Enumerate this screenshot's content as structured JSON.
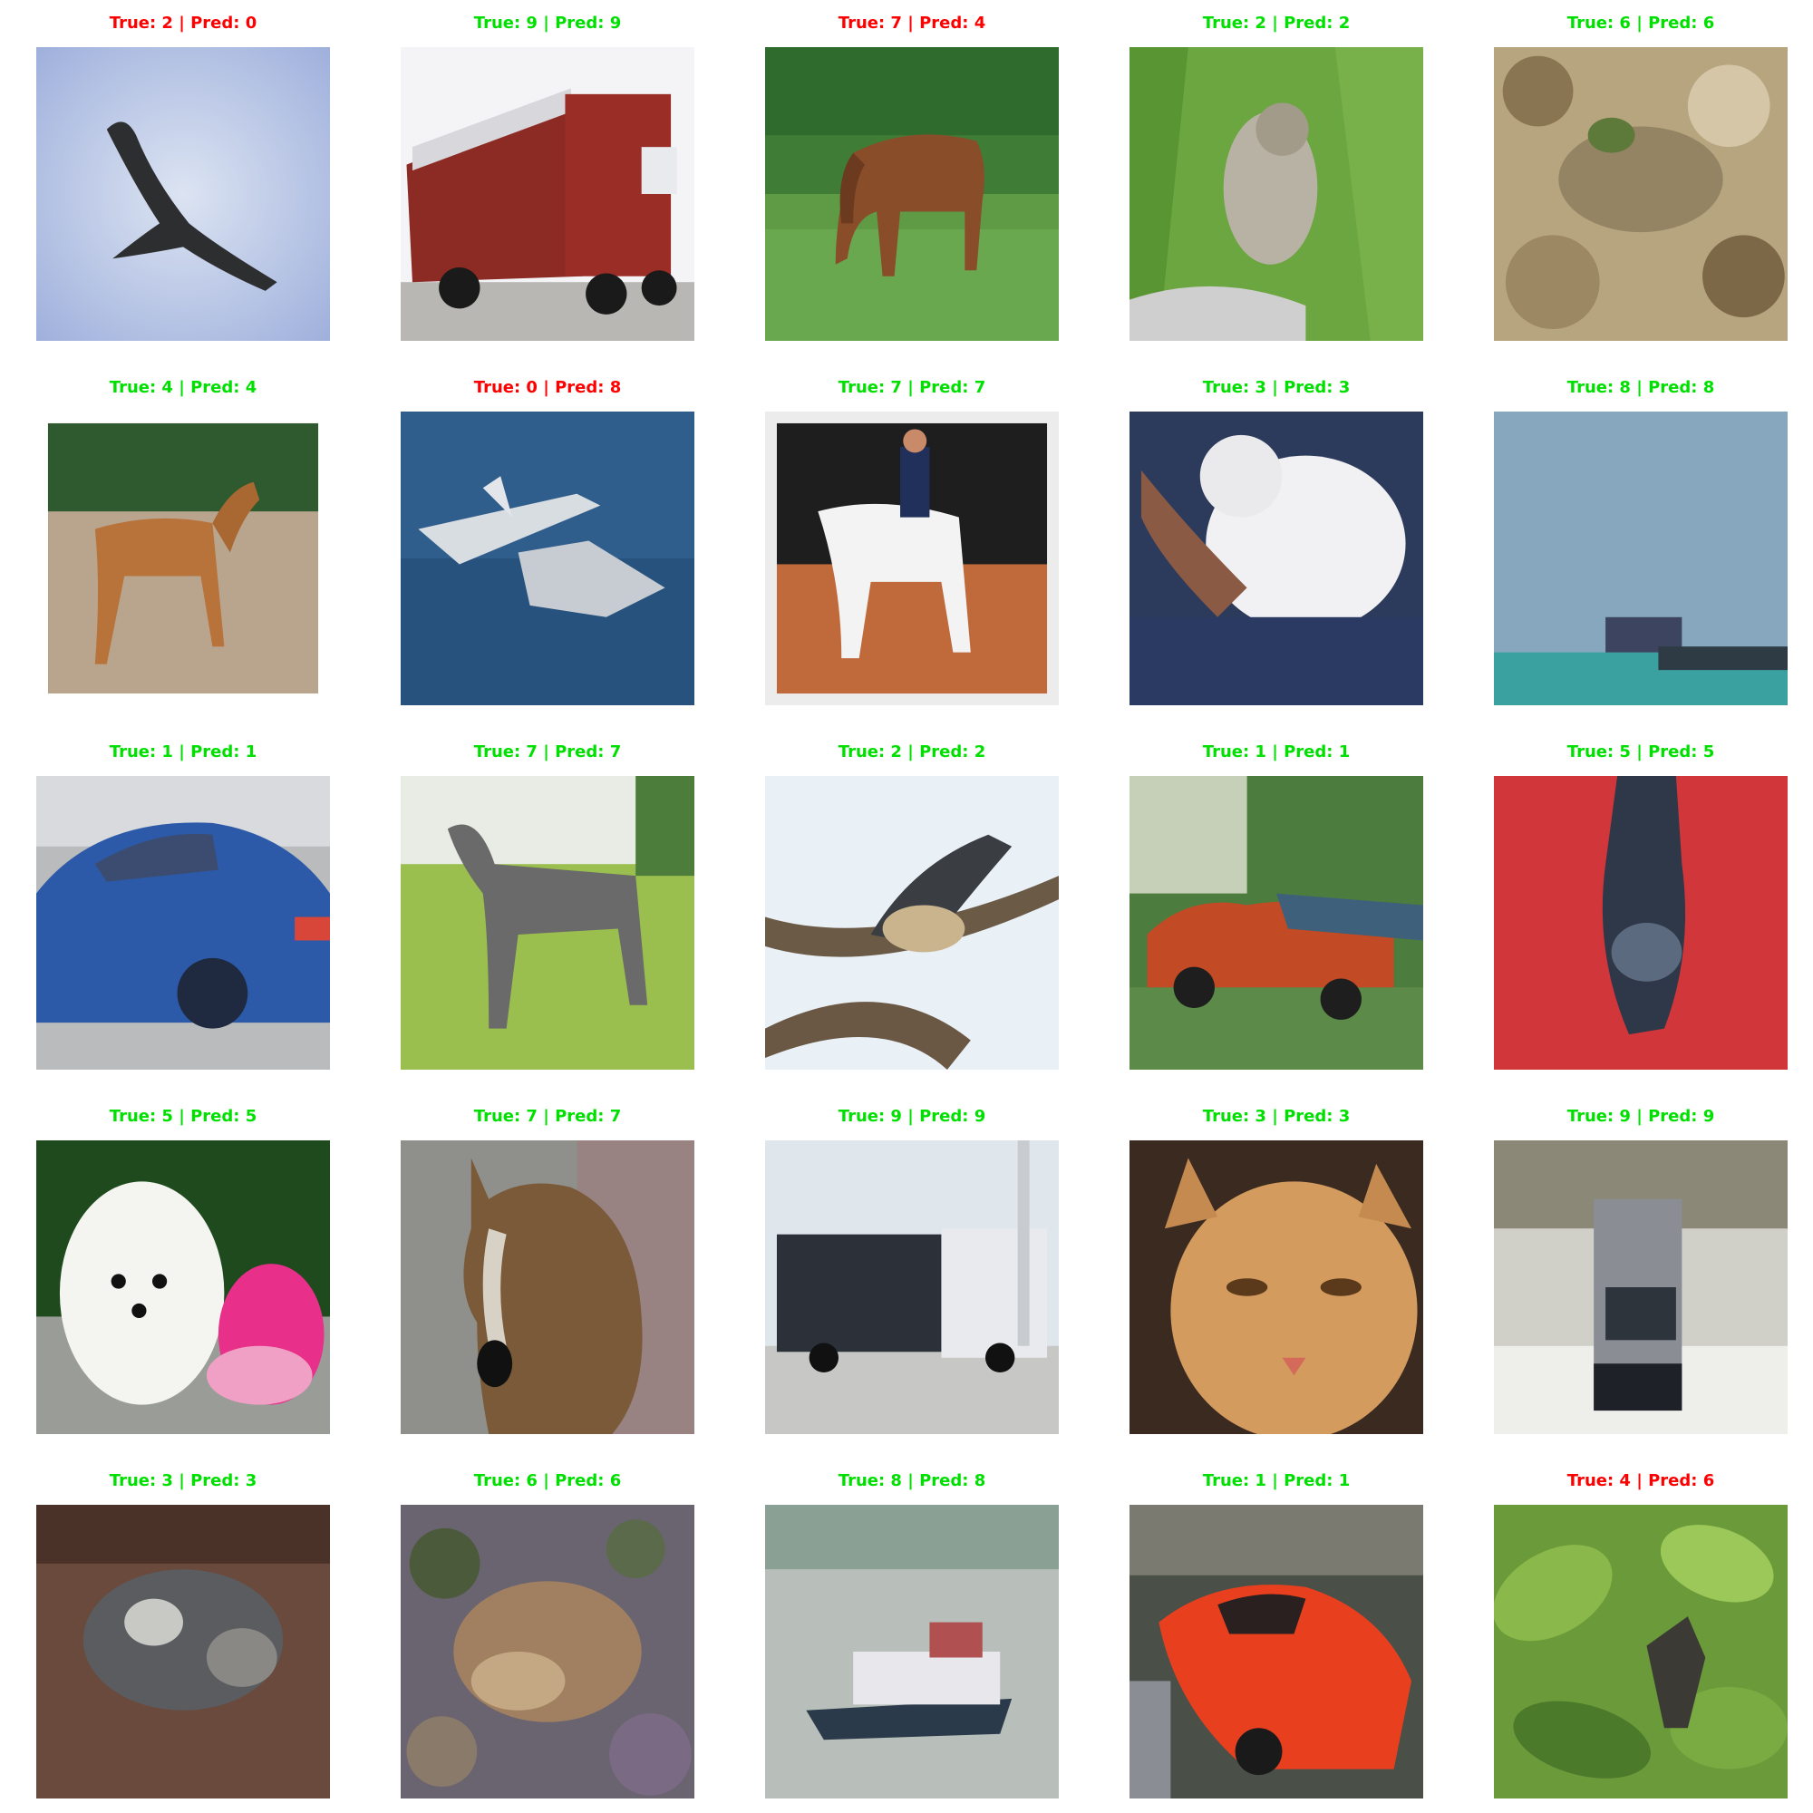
{
  "colors": {
    "correct": "#00e000",
    "incorrect": "#ff0000",
    "background": "#ffffff"
  },
  "samples": [
    {
      "label": "True: 2 | Pred: 0",
      "true": 2,
      "pred": 0,
      "correct": false,
      "scene": "bird-in-sky"
    },
    {
      "label": "True: 9 | Pred: 9",
      "true": 9,
      "pred": 9,
      "correct": true,
      "scene": "red-truck"
    },
    {
      "label": "True: 7 | Pred: 4",
      "true": 7,
      "pred": 4,
      "correct": false,
      "scene": "brown-horse-grazing"
    },
    {
      "label": "True: 2 | Pred: 2",
      "true": 2,
      "pred": 2,
      "correct": true,
      "scene": "bird-in-grass"
    },
    {
      "label": "True: 6 | Pred: 6",
      "true": 6,
      "pred": 6,
      "correct": true,
      "scene": "frog-on-ground"
    },
    {
      "label": "True: 4 | Pred: 4",
      "true": 4,
      "pred": 4,
      "correct": true,
      "scene": "deer"
    },
    {
      "label": "True: 0 | Pred: 8",
      "true": 0,
      "pred": 8,
      "correct": false,
      "scene": "airplane-over-water"
    },
    {
      "label": "True: 7 | Pred: 7",
      "true": 7,
      "pred": 7,
      "correct": true,
      "scene": "white-horse-rider"
    },
    {
      "label": "True: 3 | Pred: 3",
      "true": 3,
      "pred": 3,
      "correct": true,
      "scene": "white-cat-held"
    },
    {
      "label": "True: 8 | Pred: 8",
      "true": 8,
      "pred": 8,
      "correct": true,
      "scene": "ship-at-sea"
    },
    {
      "label": "True: 1 | Pred: 1",
      "true": 1,
      "pred": 1,
      "correct": true,
      "scene": "blue-car"
    },
    {
      "label": "True: 7 | Pred: 7",
      "true": 7,
      "pred": 7,
      "correct": true,
      "scene": "gray-horse"
    },
    {
      "label": "True: 2 | Pred: 2",
      "true": 2,
      "pred": 2,
      "correct": true,
      "scene": "bird-on-branch"
    },
    {
      "label": "True: 1 | Pred: 1",
      "true": 1,
      "pred": 1,
      "correct": true,
      "scene": "red-car-trees"
    },
    {
      "label": "True: 5 | Pred: 5",
      "true": 5,
      "pred": 5,
      "correct": true,
      "scene": "dog-on-red"
    },
    {
      "label": "True: 5 | Pred: 5",
      "true": 5,
      "pred": 5,
      "correct": true,
      "scene": "white-puppy"
    },
    {
      "label": "True: 7 | Pred: 7",
      "true": 7,
      "pred": 7,
      "correct": true,
      "scene": "horse-head"
    },
    {
      "label": "True: 9 | Pred: 9",
      "true": 9,
      "pred": 9,
      "correct": true,
      "scene": "white-truck"
    },
    {
      "label": "True: 3 | Pred: 3",
      "true": 3,
      "pred": 3,
      "correct": true,
      "scene": "orange-cat-face"
    },
    {
      "label": "True: 9 | Pred: 9",
      "true": 9,
      "pred": 9,
      "correct": true,
      "scene": "truck-front"
    },
    {
      "label": "True: 3 | Pred: 3",
      "true": 3,
      "pred": 3,
      "correct": true,
      "scene": "tabby-cat-lying"
    },
    {
      "label": "True: 6 | Pred: 6",
      "true": 6,
      "pred": 6,
      "correct": true,
      "scene": "toad"
    },
    {
      "label": "True: 8 | Pred: 8",
      "true": 8,
      "pred": 8,
      "correct": true,
      "scene": "boat-on-river"
    },
    {
      "label": "True: 1 | Pred: 1",
      "true": 1,
      "pred": 1,
      "correct": true,
      "scene": "orange-sports-car"
    },
    {
      "label": "True: 4 | Pred: 6",
      "true": 4,
      "pred": 6,
      "correct": false,
      "scene": "deer-in-leaves"
    }
  ]
}
